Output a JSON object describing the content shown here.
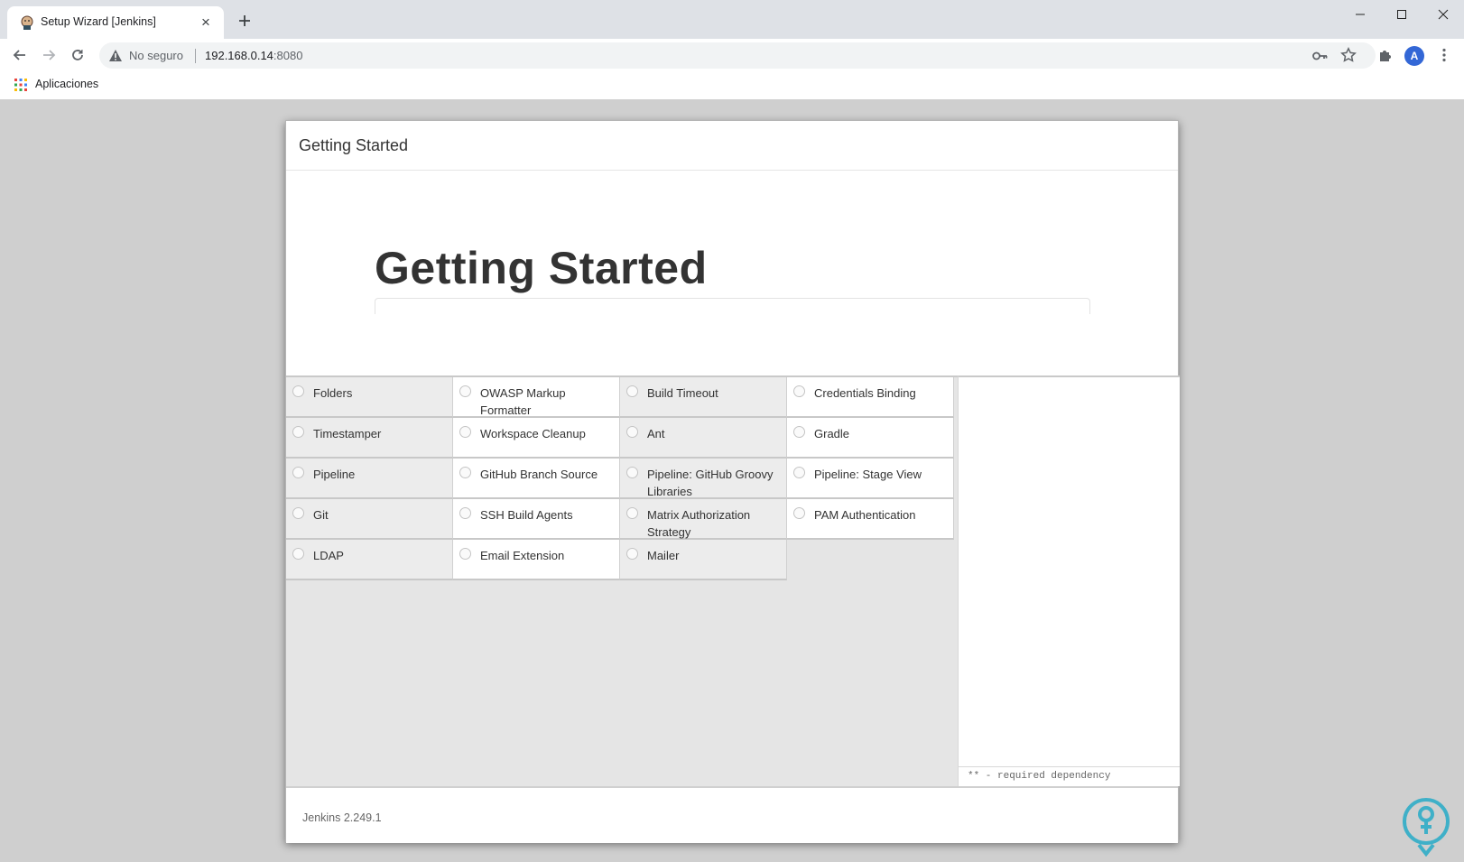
{
  "browser": {
    "tab_title": "Setup Wizard [Jenkins]",
    "not_secure_label": "No seguro",
    "url_host": "192.168.0.14",
    "url_port": ":8080",
    "avatar_letter": "A",
    "bookmarks": {
      "apps_label": "Aplicaciones"
    }
  },
  "page": {
    "modal_title": "Getting Started",
    "hero_title": "Getting Started",
    "plugins": [
      "Folders",
      "OWASP Markup Formatter",
      "Build Timeout",
      "Credentials Binding",
      "Timestamper",
      "Workspace Cleanup",
      "Ant",
      "Gradle",
      "Pipeline",
      "GitHub Branch Source",
      "Pipeline: GitHub Groovy Libraries",
      "Pipeline: Stage View",
      "Git",
      "SSH Build Agents",
      "Matrix Authorization Strategy",
      "PAM Authentication",
      "LDAP",
      "Email Extension",
      "Mailer"
    ],
    "dependency_note": "** - required dependency",
    "footer_version": "Jenkins 2.249.1"
  }
}
